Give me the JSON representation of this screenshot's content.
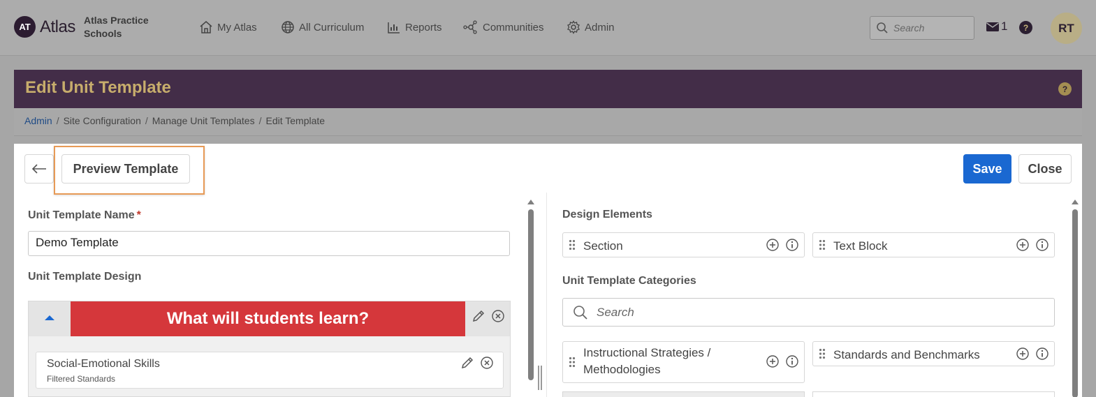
{
  "nav": {
    "logo_initials": "AT",
    "logo_word": "Atlas",
    "school_name": "Atlas Practice Schools",
    "items": [
      {
        "label": "My Atlas",
        "icon": "home-icon"
      },
      {
        "label": "All Curriculum",
        "icon": "globe-icon"
      },
      {
        "label": "Reports",
        "icon": "bar-chart-icon"
      },
      {
        "label": "Communities",
        "icon": "network-icon"
      },
      {
        "label": "Admin",
        "icon": "gear-icon"
      }
    ],
    "search_placeholder": "Search",
    "mail_count": "1",
    "help_glyph": "?",
    "user_initials": "RT"
  },
  "page": {
    "title": "Edit Unit Template",
    "help_glyph": "?",
    "breadcrumb": [
      "Admin",
      "Site Configuration",
      "Manage Unit Templates",
      "Edit Template"
    ]
  },
  "toolbar": {
    "preview_label": "Preview Template",
    "save_label": "Save",
    "close_label": "Close"
  },
  "left": {
    "name_label": "Unit Template Name",
    "required_mark": "*",
    "name_value": "Demo Template",
    "design_label": "Unit Template Design",
    "section_title": "What will students learn?",
    "card_title": "Social-Emotional Skills",
    "card_subtitle": "Filtered Standards"
  },
  "right": {
    "design_elements_label": "Design Elements",
    "design_elements": [
      "Section",
      "Text Block"
    ],
    "categories_label": "Unit Template Categories",
    "categories_search_placeholder": "Search",
    "categories": [
      "Instructional Strategies / Methodologies",
      "Standards and Benchmarks"
    ]
  },
  "colors": {
    "brand_purple": "#432d48",
    "brand_gold": "#c7ad6c",
    "primary_blue": "#1a68d1",
    "section_red": "#d5373b",
    "highlight_orange": "#e79a56"
  }
}
